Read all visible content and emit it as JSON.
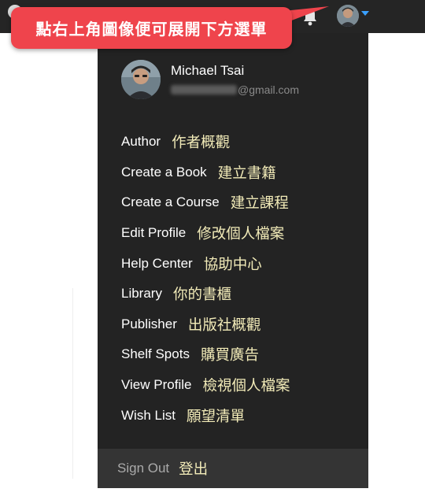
{
  "annotation": {
    "callout_text": "點右上角圖像便可展開下方選單",
    "accent_color": "#ef444c"
  },
  "topbar": {
    "background": "#252525",
    "icons": [
      "bell-icon",
      "avatar",
      "caret-down-icon"
    ]
  },
  "user": {
    "name": "Michael Tsai",
    "email_visible": "@gmail.com"
  },
  "menu": {
    "items": [
      {
        "label": "Author",
        "note": "作者概觀"
      },
      {
        "label": "Create a Book",
        "note": "建立書籍"
      },
      {
        "label": "Create a Course",
        "note": "建立課程"
      },
      {
        "label": "Edit Profile",
        "note": "修改個人檔案"
      },
      {
        "label": "Help Center",
        "note": "協助中心"
      },
      {
        "label": "Library",
        "note": "你的書櫃"
      },
      {
        "label": "Publisher",
        "note": "出版社概觀"
      },
      {
        "label": "Shelf Spots",
        "note": "購買廣告"
      },
      {
        "label": "View Profile",
        "note": "檢視個人檔案"
      },
      {
        "label": "Wish List",
        "note": "願望清單"
      }
    ],
    "footer": {
      "label": "Sign Out",
      "note": "登出"
    }
  }
}
